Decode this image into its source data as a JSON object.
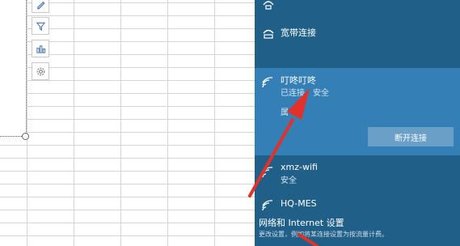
{
  "flyout": {
    "networks": [
      {
        "name": "",
        "status": "",
        "icon": "ethernet-icon"
      },
      {
        "name": "宽带连接",
        "status": "",
        "icon": "dialup-icon"
      },
      {
        "name": "叮咚叮咚",
        "status": "已连接，安全",
        "icon": "wifi-icon",
        "active": true
      },
      {
        "name": "xmz-wifi",
        "status": "安全",
        "icon": "wifi-icon"
      },
      {
        "name": "HQ-MES",
        "status": "",
        "icon": "wifi-icon"
      }
    ],
    "active_partial_text": "属",
    "disconnect_label": "断开连接",
    "settings_link": "网络和 Internet 设置",
    "settings_desc": "更改设置，例如将某连接设置为按流量计费。"
  },
  "sheet": {
    "chart_tools": [
      "pen-icon",
      "filter-icon",
      "chart-style-icon",
      "gear-icon"
    ]
  },
  "colors": {
    "flyout_bg": "#205f88",
    "active_row_bg": "#3480b6",
    "disconnect_bg": "#6a9fc8",
    "arrow": "#e0312b"
  }
}
